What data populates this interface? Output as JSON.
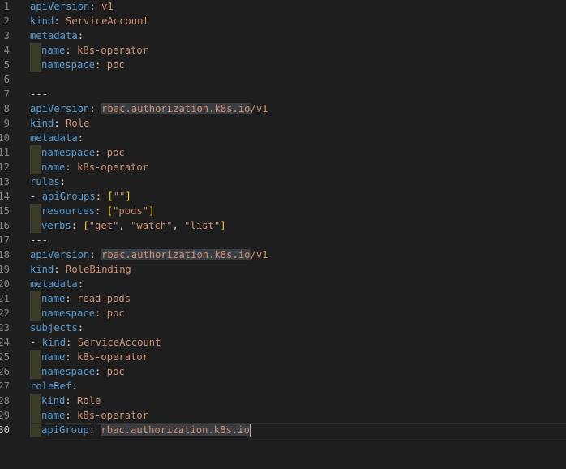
{
  "editor": {
    "language": "yaml",
    "active_line": 30,
    "lines": [
      {
        "n": "1",
        "indent": 0,
        "tokens": [
          [
            "k",
            "apiVersion"
          ],
          [
            "p",
            ": "
          ],
          [
            "v",
            "v1"
          ]
        ]
      },
      {
        "n": "2",
        "indent": 0,
        "tokens": [
          [
            "k",
            "kind"
          ],
          [
            "p",
            ": "
          ],
          [
            "v",
            "ServiceAccount"
          ]
        ]
      },
      {
        "n": "3",
        "indent": 0,
        "tokens": [
          [
            "k",
            "metadata"
          ],
          [
            "p",
            ":"
          ]
        ]
      },
      {
        "n": "4",
        "indent": 1,
        "tokens": [
          [
            "k",
            "name"
          ],
          [
            "p",
            ": "
          ],
          [
            "v",
            "k8s-operator"
          ]
        ]
      },
      {
        "n": "5",
        "indent": 1,
        "tokens": [
          [
            "k",
            "namespace"
          ],
          [
            "p",
            ": "
          ],
          [
            "v",
            "poc"
          ]
        ]
      },
      {
        "n": "6",
        "indent": 0,
        "tokens": []
      },
      {
        "n": "7",
        "indent": 0,
        "tokens": [
          [
            "s",
            "---"
          ]
        ]
      },
      {
        "n": "8",
        "indent": 0,
        "tokens": [
          [
            "k",
            "apiVersion"
          ],
          [
            "p",
            ": "
          ],
          [
            "h",
            "rbac.authorization.k8s.io"
          ],
          [
            "v",
            "/v1"
          ]
        ]
      },
      {
        "n": "9",
        "indent": 0,
        "tokens": [
          [
            "k",
            "kind"
          ],
          [
            "p",
            ": "
          ],
          [
            "v",
            "Role"
          ]
        ]
      },
      {
        "n": "10",
        "indent": 0,
        "tokens": [
          [
            "k",
            "metadata"
          ],
          [
            "p",
            ":"
          ]
        ]
      },
      {
        "n": "11",
        "indent": 1,
        "tokens": [
          [
            "k",
            "namespace"
          ],
          [
            "p",
            ": "
          ],
          [
            "v",
            "poc"
          ]
        ]
      },
      {
        "n": "12",
        "indent": 1,
        "tokens": [
          [
            "k",
            "name"
          ],
          [
            "p",
            ": "
          ],
          [
            "v",
            "k8s-operator"
          ]
        ]
      },
      {
        "n": "13",
        "indent": 0,
        "tokens": [
          [
            "k",
            "rules"
          ],
          [
            "p",
            ":"
          ]
        ]
      },
      {
        "n": "14",
        "indent": 0,
        "tokens": [
          [
            "p",
            "- "
          ],
          [
            "k",
            "apiGroups"
          ],
          [
            "p",
            ": "
          ],
          [
            "b",
            "["
          ],
          [
            "v",
            "\"\""
          ],
          [
            "b",
            "]"
          ]
        ]
      },
      {
        "n": "15",
        "indent": 1,
        "tokens": [
          [
            "k",
            "resources"
          ],
          [
            "p",
            ": "
          ],
          [
            "b",
            "["
          ],
          [
            "v",
            "\"pods\""
          ],
          [
            "b",
            "]"
          ]
        ]
      },
      {
        "n": "16",
        "indent": 1,
        "tokens": [
          [
            "k",
            "verbs"
          ],
          [
            "p",
            ": "
          ],
          [
            "b",
            "["
          ],
          [
            "v",
            "\"get\""
          ],
          [
            "p",
            ", "
          ],
          [
            "v",
            "\"watch\""
          ],
          [
            "p",
            ", "
          ],
          [
            "v",
            "\"list\""
          ],
          [
            "b",
            "]"
          ]
        ]
      },
      {
        "n": "17",
        "indent": 0,
        "tokens": [
          [
            "s",
            "---"
          ]
        ]
      },
      {
        "n": "18",
        "indent": 0,
        "tokens": [
          [
            "k",
            "apiVersion"
          ],
          [
            "p",
            ": "
          ],
          [
            "h",
            "rbac.authorization.k8s.io"
          ],
          [
            "v",
            "/v1"
          ]
        ]
      },
      {
        "n": "19",
        "indent": 0,
        "tokens": [
          [
            "k",
            "kind"
          ],
          [
            "p",
            ": "
          ],
          [
            "v",
            "RoleBinding"
          ]
        ]
      },
      {
        "n": "20",
        "indent": 0,
        "tokens": [
          [
            "k",
            "metadata"
          ],
          [
            "p",
            ":"
          ]
        ]
      },
      {
        "n": "21",
        "indent": 1,
        "tokens": [
          [
            "k",
            "name"
          ],
          [
            "p",
            ": "
          ],
          [
            "v",
            "read-pods"
          ]
        ]
      },
      {
        "n": "22",
        "indent": 1,
        "tokens": [
          [
            "k",
            "namespace"
          ],
          [
            "p",
            ": "
          ],
          [
            "v",
            "poc"
          ]
        ]
      },
      {
        "n": "23",
        "indent": 0,
        "tokens": [
          [
            "k",
            "subjects"
          ],
          [
            "p",
            ":"
          ]
        ]
      },
      {
        "n": "24",
        "indent": 0,
        "tokens": [
          [
            "p",
            "- "
          ],
          [
            "k",
            "kind"
          ],
          [
            "p",
            ": "
          ],
          [
            "v",
            "ServiceAccount"
          ]
        ]
      },
      {
        "n": "25",
        "indent": 1,
        "tokens": [
          [
            "k",
            "name"
          ],
          [
            "p",
            ": "
          ],
          [
            "v",
            "k8s-operator"
          ]
        ]
      },
      {
        "n": "26",
        "indent": 1,
        "tokens": [
          [
            "k",
            "namespace"
          ],
          [
            "p",
            ": "
          ],
          [
            "v",
            "poc"
          ]
        ]
      },
      {
        "n": "27",
        "indent": 0,
        "tokens": [
          [
            "k",
            "roleRef"
          ],
          [
            "p",
            ":"
          ]
        ]
      },
      {
        "n": "28",
        "indent": 1,
        "tokens": [
          [
            "k",
            "kind"
          ],
          [
            "p",
            ": "
          ],
          [
            "v",
            "Role"
          ]
        ]
      },
      {
        "n": "29",
        "indent": 1,
        "tokens": [
          [
            "k",
            "name"
          ],
          [
            "p",
            ": "
          ],
          [
            "v",
            "k8s-operator"
          ]
        ]
      },
      {
        "n": "30",
        "indent": 1,
        "tokens": [
          [
            "k",
            "apiGroup"
          ],
          [
            "p",
            ": "
          ],
          [
            "h",
            "rbac.authorization.k8s.io"
          ]
        ]
      }
    ]
  },
  "colors": {
    "background": "#1e1e1e",
    "key": "#569cd6",
    "string": "#ce9178",
    "bracket": "#ffd700",
    "line_number": "#858585"
  }
}
